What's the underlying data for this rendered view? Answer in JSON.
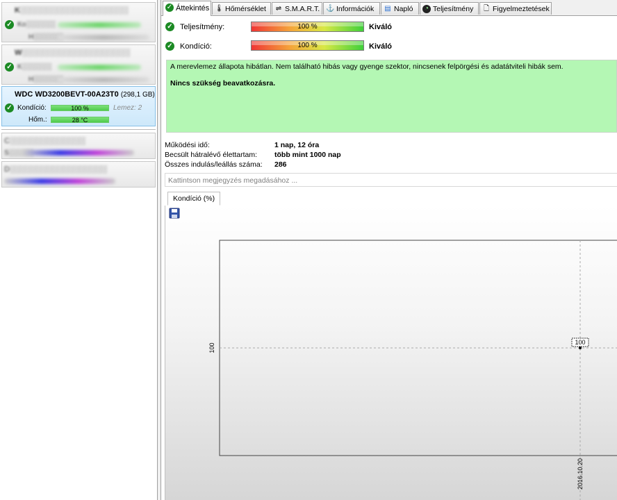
{
  "sidebar": {
    "disks": [
      {
        "name": "K░░░░░░░░░░░░░░░░░░░░",
        "row1": "Ko░░░░░░",
        "row2": "H░░░░░░"
      },
      {
        "name": "W░░░░░░░░░░░░░░░░░░░░",
        "row1": "K░░░░░░",
        "row2": "H░░░░░░"
      },
      {
        "name": "WDC WD3200BEVT-00A23T0",
        "size": "(298,1 GB)",
        "health_label": "Kondíció:",
        "health_value": "100 %",
        "disk_label": "Lemez: 2",
        "temp_label": "Hőm.:",
        "temp_value": "28 °C"
      }
    ],
    "other": [
      {
        "name": "C░░░░░░░░░░░░░░",
        "row": "S░░░░░"
      },
      {
        "name": "D░░░░░░░░░░░░░░░░░░"
      }
    ]
  },
  "tabs": [
    {
      "label": "Áttekintés",
      "icon": "check-circle-icon"
    },
    {
      "label": "Hőmérséklet",
      "icon": "thermometer-icon"
    },
    {
      "label": "S.M.A.R.T.",
      "icon": "smart-icon"
    },
    {
      "label": "Információk",
      "icon": "info-icon"
    },
    {
      "label": "Napló",
      "icon": "log-icon"
    },
    {
      "label": "Teljesítmény",
      "icon": "performance-icon"
    },
    {
      "label": "Figyelmeztetések",
      "icon": "alerts-icon"
    }
  ],
  "overview": {
    "performance_label": "Teljesítmény:",
    "performance_value": "100 %",
    "performance_rating": "Kiváló",
    "health_label": "Kondíció:",
    "health_value": "100 %",
    "health_rating": "Kiváló",
    "status_text": "A merevlemez állapota hibátlan. Nem található hibás vagy gyenge szektor, nincsenek felpörgési és adatátviteli hibák sem.",
    "status_action": "Nincs szükség beavatkozásra.",
    "uptime_label": "Működési idő:",
    "uptime_value": "1 nap, 12 óra",
    "lifetime_label": "Becsült hátralévő élettartam:",
    "lifetime_value": "több mint 1000 nap",
    "startstop_label": "Összes indulás/leállás száma:",
    "startstop_value": "286",
    "comment_placeholder": "Kattintson megjegyzés megadásához ..."
  },
  "chart_tab": "Kondíció  (%)",
  "chart_data": {
    "type": "line",
    "title": "",
    "ylabel": "",
    "xlabel": "",
    "x": [
      "2016.10.20"
    ],
    "series": [
      {
        "values": [
          100
        ]
      }
    ],
    "ytick": "100",
    "data_label": "100",
    "grid": true
  },
  "colors": {
    "status_bg": "#b4f7b4",
    "ok_green": "#1c8a24"
  }
}
